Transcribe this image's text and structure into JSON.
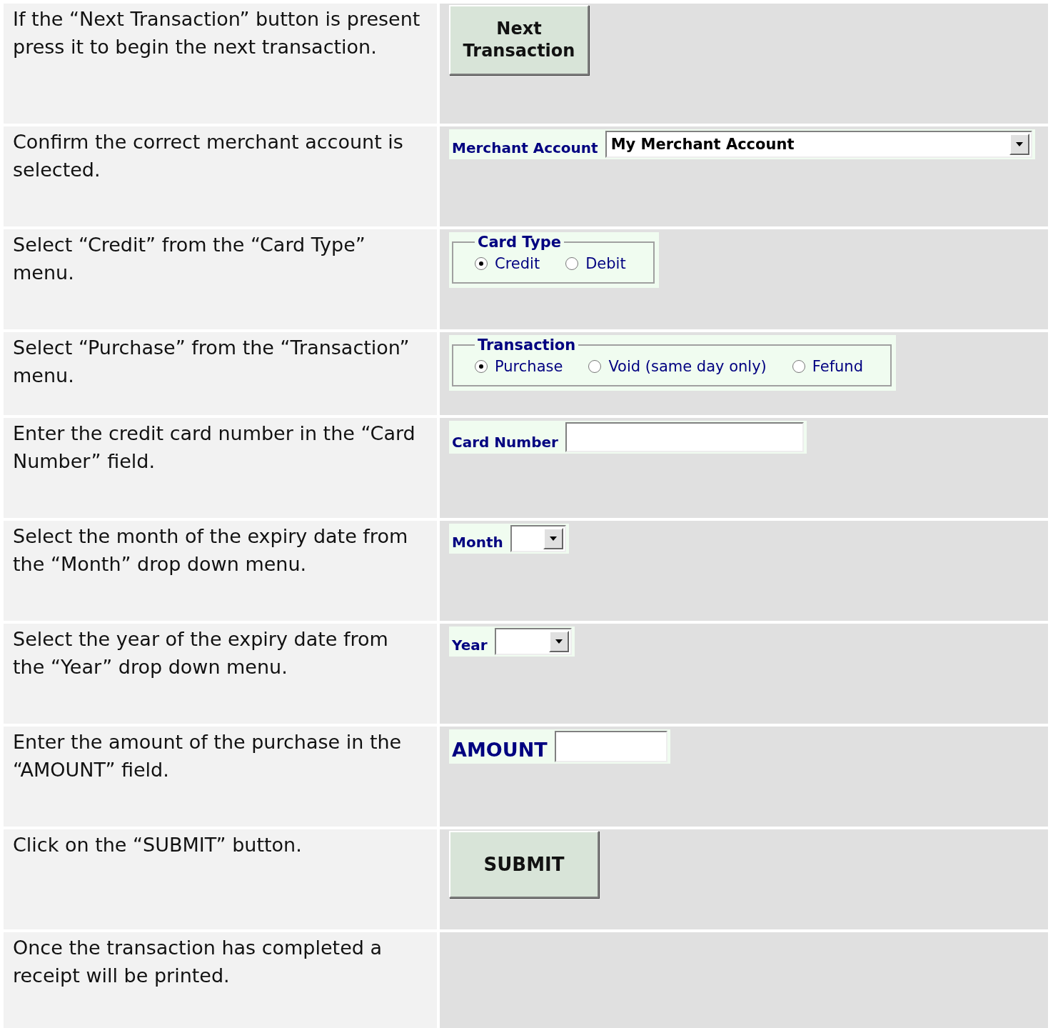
{
  "steps": [
    {
      "instruction": "If the “Next Transaction” button is present press it to begin the next transaction.",
      "widget": {
        "kind": "button",
        "label": "Next Transaction"
      }
    },
    {
      "instruction": "Confirm the correct merchant account is selected.",
      "widget": {
        "kind": "select",
        "label": "Merchant Account",
        "value": "My Merchant Account"
      }
    },
    {
      "instruction": "Select “Credit” from the “Card Type” menu.",
      "widget": {
        "kind": "radio_group",
        "title": "Card Type",
        "options": [
          {
            "label": "Credit",
            "selected": true
          },
          {
            "label": "Debit",
            "selected": false
          }
        ]
      }
    },
    {
      "instruction": "Select “Purchase” from the “Transaction” menu.",
      "widget": {
        "kind": "radio_group",
        "title": "Transaction",
        "options": [
          {
            "label": "Purchase",
            "selected": true
          },
          {
            "label": "Void (same day only)",
            "selected": false
          },
          {
            "label": "Fefund",
            "selected": false
          }
        ]
      }
    },
    {
      "instruction": "Enter the credit card number in the “Card Number” field.",
      "widget": {
        "kind": "text_field",
        "label": "Card Number"
      }
    },
    {
      "instruction": "Select the month of the expiry date from the “Month” drop down menu.",
      "widget": {
        "kind": "select",
        "label": "Month"
      }
    },
    {
      "instruction": "Select the year of the expiry date from the “Year” drop down menu.",
      "widget": {
        "kind": "select",
        "label": "Year"
      }
    },
    {
      "instruction": "Enter the amount of the purchase in the “AMOUNT” field.",
      "widget": {
        "kind": "text_field",
        "label": "AMOUNT"
      }
    },
    {
      "instruction": "Click on the “SUBMIT” button.",
      "widget": {
        "kind": "button",
        "label": "SUBMIT"
      }
    },
    {
      "instruction": "Once the transaction has completed a receipt will be printed."
    }
  ]
}
